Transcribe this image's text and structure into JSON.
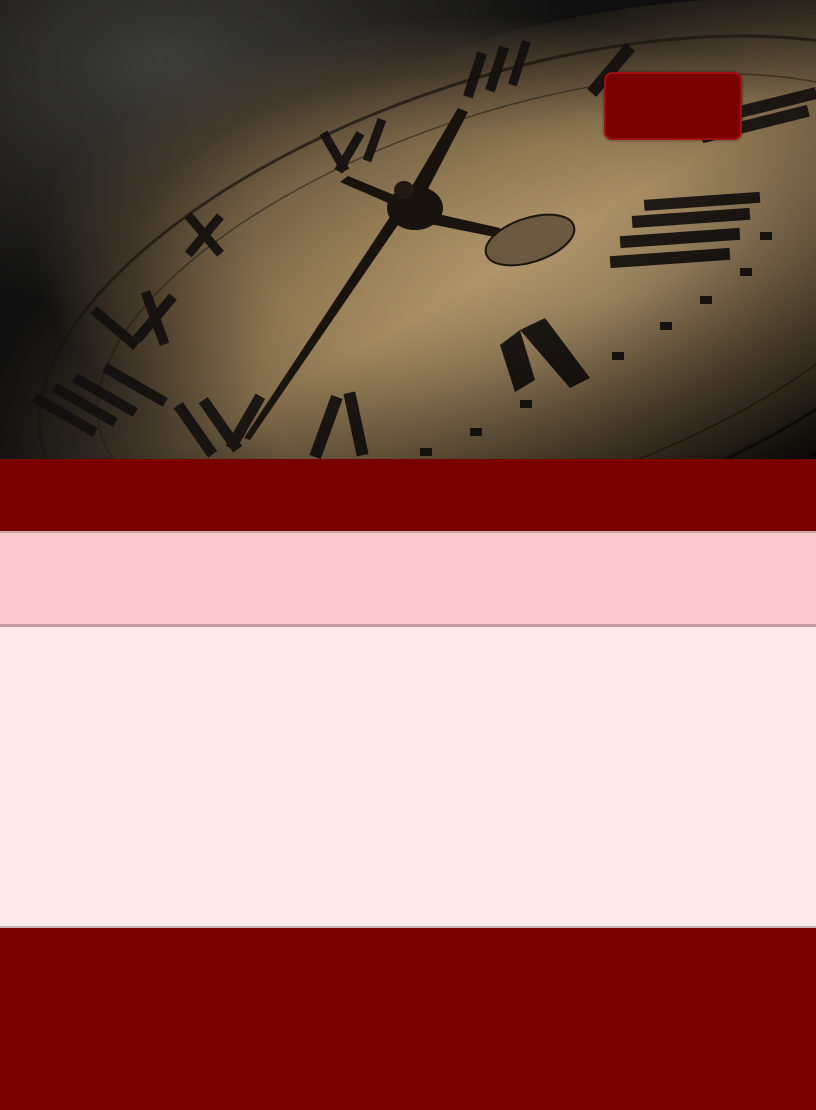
{
  "hero": {
    "image_name": "antique-clock-face-image",
    "button_label": ""
  },
  "colors": {
    "accent_dark_red": "#7a0000",
    "band_pink": "#ffc9cf",
    "band_light_pink": "#ffe9eb"
  },
  "sections": {
    "top_band_text": "",
    "pink_band_text": "",
    "content_text": "",
    "footer_text": ""
  }
}
